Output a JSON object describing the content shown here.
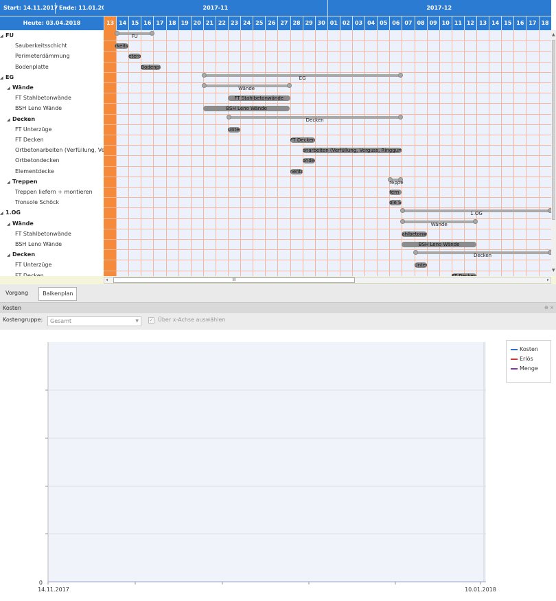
{
  "header": {
    "start_label": "Start: 14.11.2017",
    "end_label": "Ende: 11.01.2018",
    "today_label": "Heute: 03.04.2018"
  },
  "timeline": {
    "months": [
      {
        "label": "2017-11"
      },
      {
        "label": "2017-12"
      }
    ],
    "days": [
      "13",
      "14",
      "15",
      "16",
      "17",
      "18",
      "19",
      "20",
      "21",
      "22",
      "23",
      "24",
      "25",
      "26",
      "27",
      "28",
      "29",
      "30",
      "01",
      "02",
      "03",
      "04",
      "05",
      "06",
      "07",
      "08",
      "09",
      "10",
      "11",
      "12",
      "13",
      "14",
      "15",
      "16",
      "17",
      "18"
    ],
    "today_day_index": 0
  },
  "tasks": [
    {
      "label": "FU",
      "bold": true,
      "caret": true
    },
    {
      "label": "Sauberkeitsschicht"
    },
    {
      "label": "Perimeterdämmung"
    },
    {
      "label": "Bodenplatte"
    },
    {
      "label": "EG",
      "bold": true,
      "caret": true
    },
    {
      "label": "Wände",
      "bold": true,
      "caret": true
    },
    {
      "label": "FT Stahlbetonwände"
    },
    {
      "label": "BSH Leno Wände"
    },
    {
      "label": "Decken",
      "bold": true,
      "caret": true
    },
    {
      "label": "FT Unterzüge"
    },
    {
      "label": "FT Decken"
    },
    {
      "label": "Ortbetonarbeiten (Verfüllung, Ver"
    },
    {
      "label": "Ortbetondecken"
    },
    {
      "label": "Elementdecke"
    },
    {
      "label": "Treppen",
      "bold": true,
      "caret": true
    },
    {
      "label": "Treppen liefern + montieren"
    },
    {
      "label": "Tronsole Schöck"
    },
    {
      "label": "1.OG",
      "bold": true,
      "caret": true
    },
    {
      "label": "Wände",
      "bold": true,
      "caret": true
    },
    {
      "label": "FT Stahlbetonwände"
    },
    {
      "label": "BSH Leno Wände"
    },
    {
      "label": "Decken",
      "bold": true,
      "caret": true
    },
    {
      "label": "FT Unterzüge"
    },
    {
      "label": "FT Decken"
    }
  ],
  "bars": [
    {
      "row": 0,
      "start": 1,
      "end": 4,
      "label": "FU",
      "summary": true
    },
    {
      "row": 1,
      "start": 0.9,
      "end": 2,
      "label": "rkeitss"
    },
    {
      "row": 2,
      "start": 2,
      "end": 3,
      "label": "eterdär"
    },
    {
      "row": 3,
      "start": 3,
      "end": 4.6,
      "label": "Bodenplatte"
    },
    {
      "row": 4,
      "start": 8,
      "end": 24,
      "label": "EG",
      "summary": true
    },
    {
      "row": 5,
      "start": 8,
      "end": 15,
      "label": "Wände",
      "summary": true
    },
    {
      "row": 6,
      "start": 10,
      "end": 15,
      "label": "FT Stahlbetonwände"
    },
    {
      "row": 7,
      "start": 8,
      "end": 15,
      "label": "BSH Leno Wände"
    },
    {
      "row": 8,
      "start": 10,
      "end": 24,
      "label": "Decken",
      "summary": true
    },
    {
      "row": 9,
      "start": 10,
      "end": 11,
      "label": "Unterz"
    },
    {
      "row": 10,
      "start": 15,
      "end": 17,
      "label": "FT Decken"
    },
    {
      "row": 11,
      "start": 16,
      "end": 24,
      "label": "onarbeiten (Verfüllung, Verguss, Ringgurt, Au"
    },
    {
      "row": 12,
      "start": 16,
      "end": 17,
      "label": "ondec"
    },
    {
      "row": 13,
      "start": 15,
      "end": 16,
      "label": "nentdec"
    },
    {
      "row": 14,
      "start": 23,
      "end": 24,
      "label": "reppe",
      "summary": true
    },
    {
      "row": 15,
      "start": 23,
      "end": 24,
      "label": "fern +"
    },
    {
      "row": 16,
      "start": 23,
      "end": 24,
      "label": "ole Sc"
    },
    {
      "row": 17,
      "start": 24,
      "end": 36,
      "label": "1.OG",
      "summary": true
    },
    {
      "row": 18,
      "start": 24,
      "end": 30,
      "label": "Wände",
      "summary": true
    },
    {
      "row": 19,
      "start": 24,
      "end": 26,
      "label": "ahlbetonw"
    },
    {
      "row": 20,
      "start": 24,
      "end": 30,
      "label": "BSH Leno Wände"
    },
    {
      "row": 21,
      "start": 25,
      "end": 36,
      "label": "Decken",
      "summary": true
    },
    {
      "row": 22,
      "start": 25,
      "end": 26,
      "label": "Unterz"
    },
    {
      "row": 23,
      "start": 28,
      "end": 30,
      "label": "FT Decken"
    }
  ],
  "hscroll": {
    "thumb_label": "III"
  },
  "tabs": [
    {
      "label": "Vorgang",
      "active": false
    },
    {
      "label": "Balkenplan",
      "active": true
    }
  ],
  "cost_panel": {
    "title": "Kosten",
    "pin_glyph": "⊕ ×",
    "group_label": "Kostengruppe:",
    "group_value": "Gesamt",
    "axis_checkbox_label": "Über x-Achse auswählen"
  },
  "chart_data": {
    "type": "line",
    "x_start_label": "14.11.2017",
    "x_end_label": "10.01.2018",
    "y_zero_label": "0",
    "series": [
      {
        "name": "Kosten",
        "color": "#2b6fd0",
        "values": []
      },
      {
        "name": "Erlös",
        "color": "#d03030",
        "values": []
      },
      {
        "name": "Menge",
        "color": "#7a3b8c",
        "values": []
      }
    ],
    "grid": true,
    "legend": "top-right"
  },
  "colors": {
    "header_blue": "#2b7bd3",
    "today_orange": "#f58a3a",
    "grid_line": "#f3b89a",
    "grid_bg": "#edf1fb"
  }
}
